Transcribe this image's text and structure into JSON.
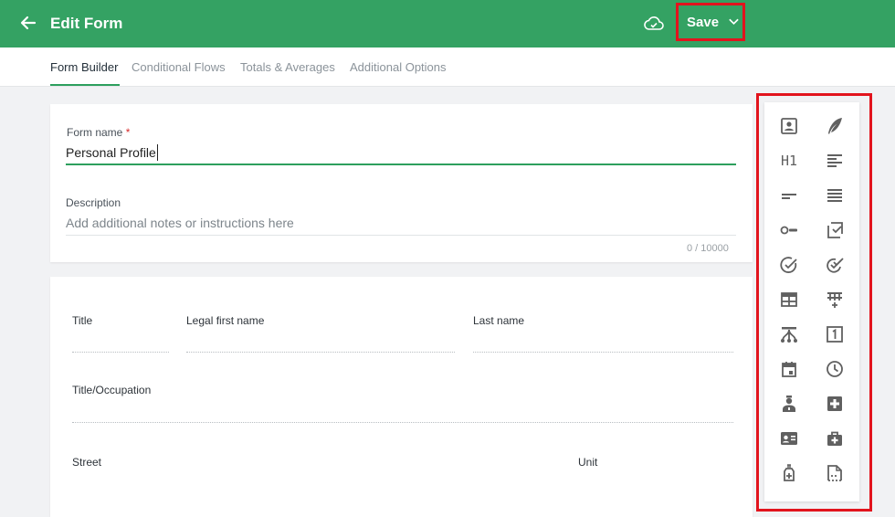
{
  "header": {
    "title": "Edit Form",
    "save_label": "Save"
  },
  "tabs": [
    "Form Builder",
    "Conditional Flows",
    "Totals & Averages",
    "Additional Options"
  ],
  "form": {
    "name_label": "Form name",
    "required_mark": "*",
    "name_value": "Personal Profile",
    "description_label": "Description",
    "description_placeholder": "Add additional notes or instructions here",
    "char_counter": "0 / 10000"
  },
  "fields": {
    "title": "Title",
    "first_name": "Legal first name",
    "last_name": "Last name",
    "occupation": "Title/Occupation",
    "street": "Street",
    "unit": "Unit"
  },
  "palette_icons": [
    "contact-card-icon",
    "signature-feather-icon",
    "heading-h1-icon",
    "paragraph-icon",
    "short-text-icon",
    "long-text-icon",
    "toggle-option-icon",
    "checklist-icon",
    "single-check-icon",
    "double-check-icon",
    "table-icon",
    "grid-add-icon",
    "branch-flow-icon",
    "number-box-icon",
    "calendar-icon",
    "clock-icon",
    "doctor-icon",
    "medical-cross-icon",
    "id-card-icon",
    "medical-bag-icon",
    "medicine-bottle-icon",
    "document-dashed-icon"
  ],
  "colors": {
    "header": "#34a263",
    "accent": "#2d9f5d",
    "highlight": "#e2141d"
  }
}
